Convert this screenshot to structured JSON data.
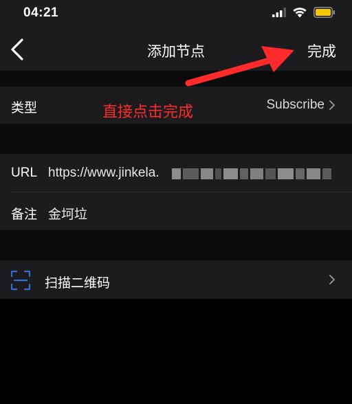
{
  "status_bar": {
    "time": "04:21"
  },
  "nav": {
    "title": "添加节点",
    "done_label": "完成"
  },
  "type_row": {
    "label": "类型",
    "value": "Subscribe"
  },
  "annotation": {
    "text": "直接点击完成",
    "color": "#ff2a2a"
  },
  "url_row": {
    "label": "URL",
    "value": "https://www.jinkela."
  },
  "remark_row": {
    "label": "备注",
    "value": "金坷垃"
  },
  "scan_row": {
    "label": "扫描二维码"
  },
  "icons": {
    "back": "chevron-left-icon",
    "signal": "cellular-signal-icon",
    "wifi": "wifi-icon",
    "battery": "battery-icon",
    "scan": "qr-scan-icon",
    "chevron": "chevron-right-icon"
  },
  "colors": {
    "background": "#000000",
    "cell": "#1c1c1e",
    "accent_annotation": "#ff2a2a",
    "battery_fill": "#f5c800",
    "scan_icon": "#2f6fd6"
  }
}
